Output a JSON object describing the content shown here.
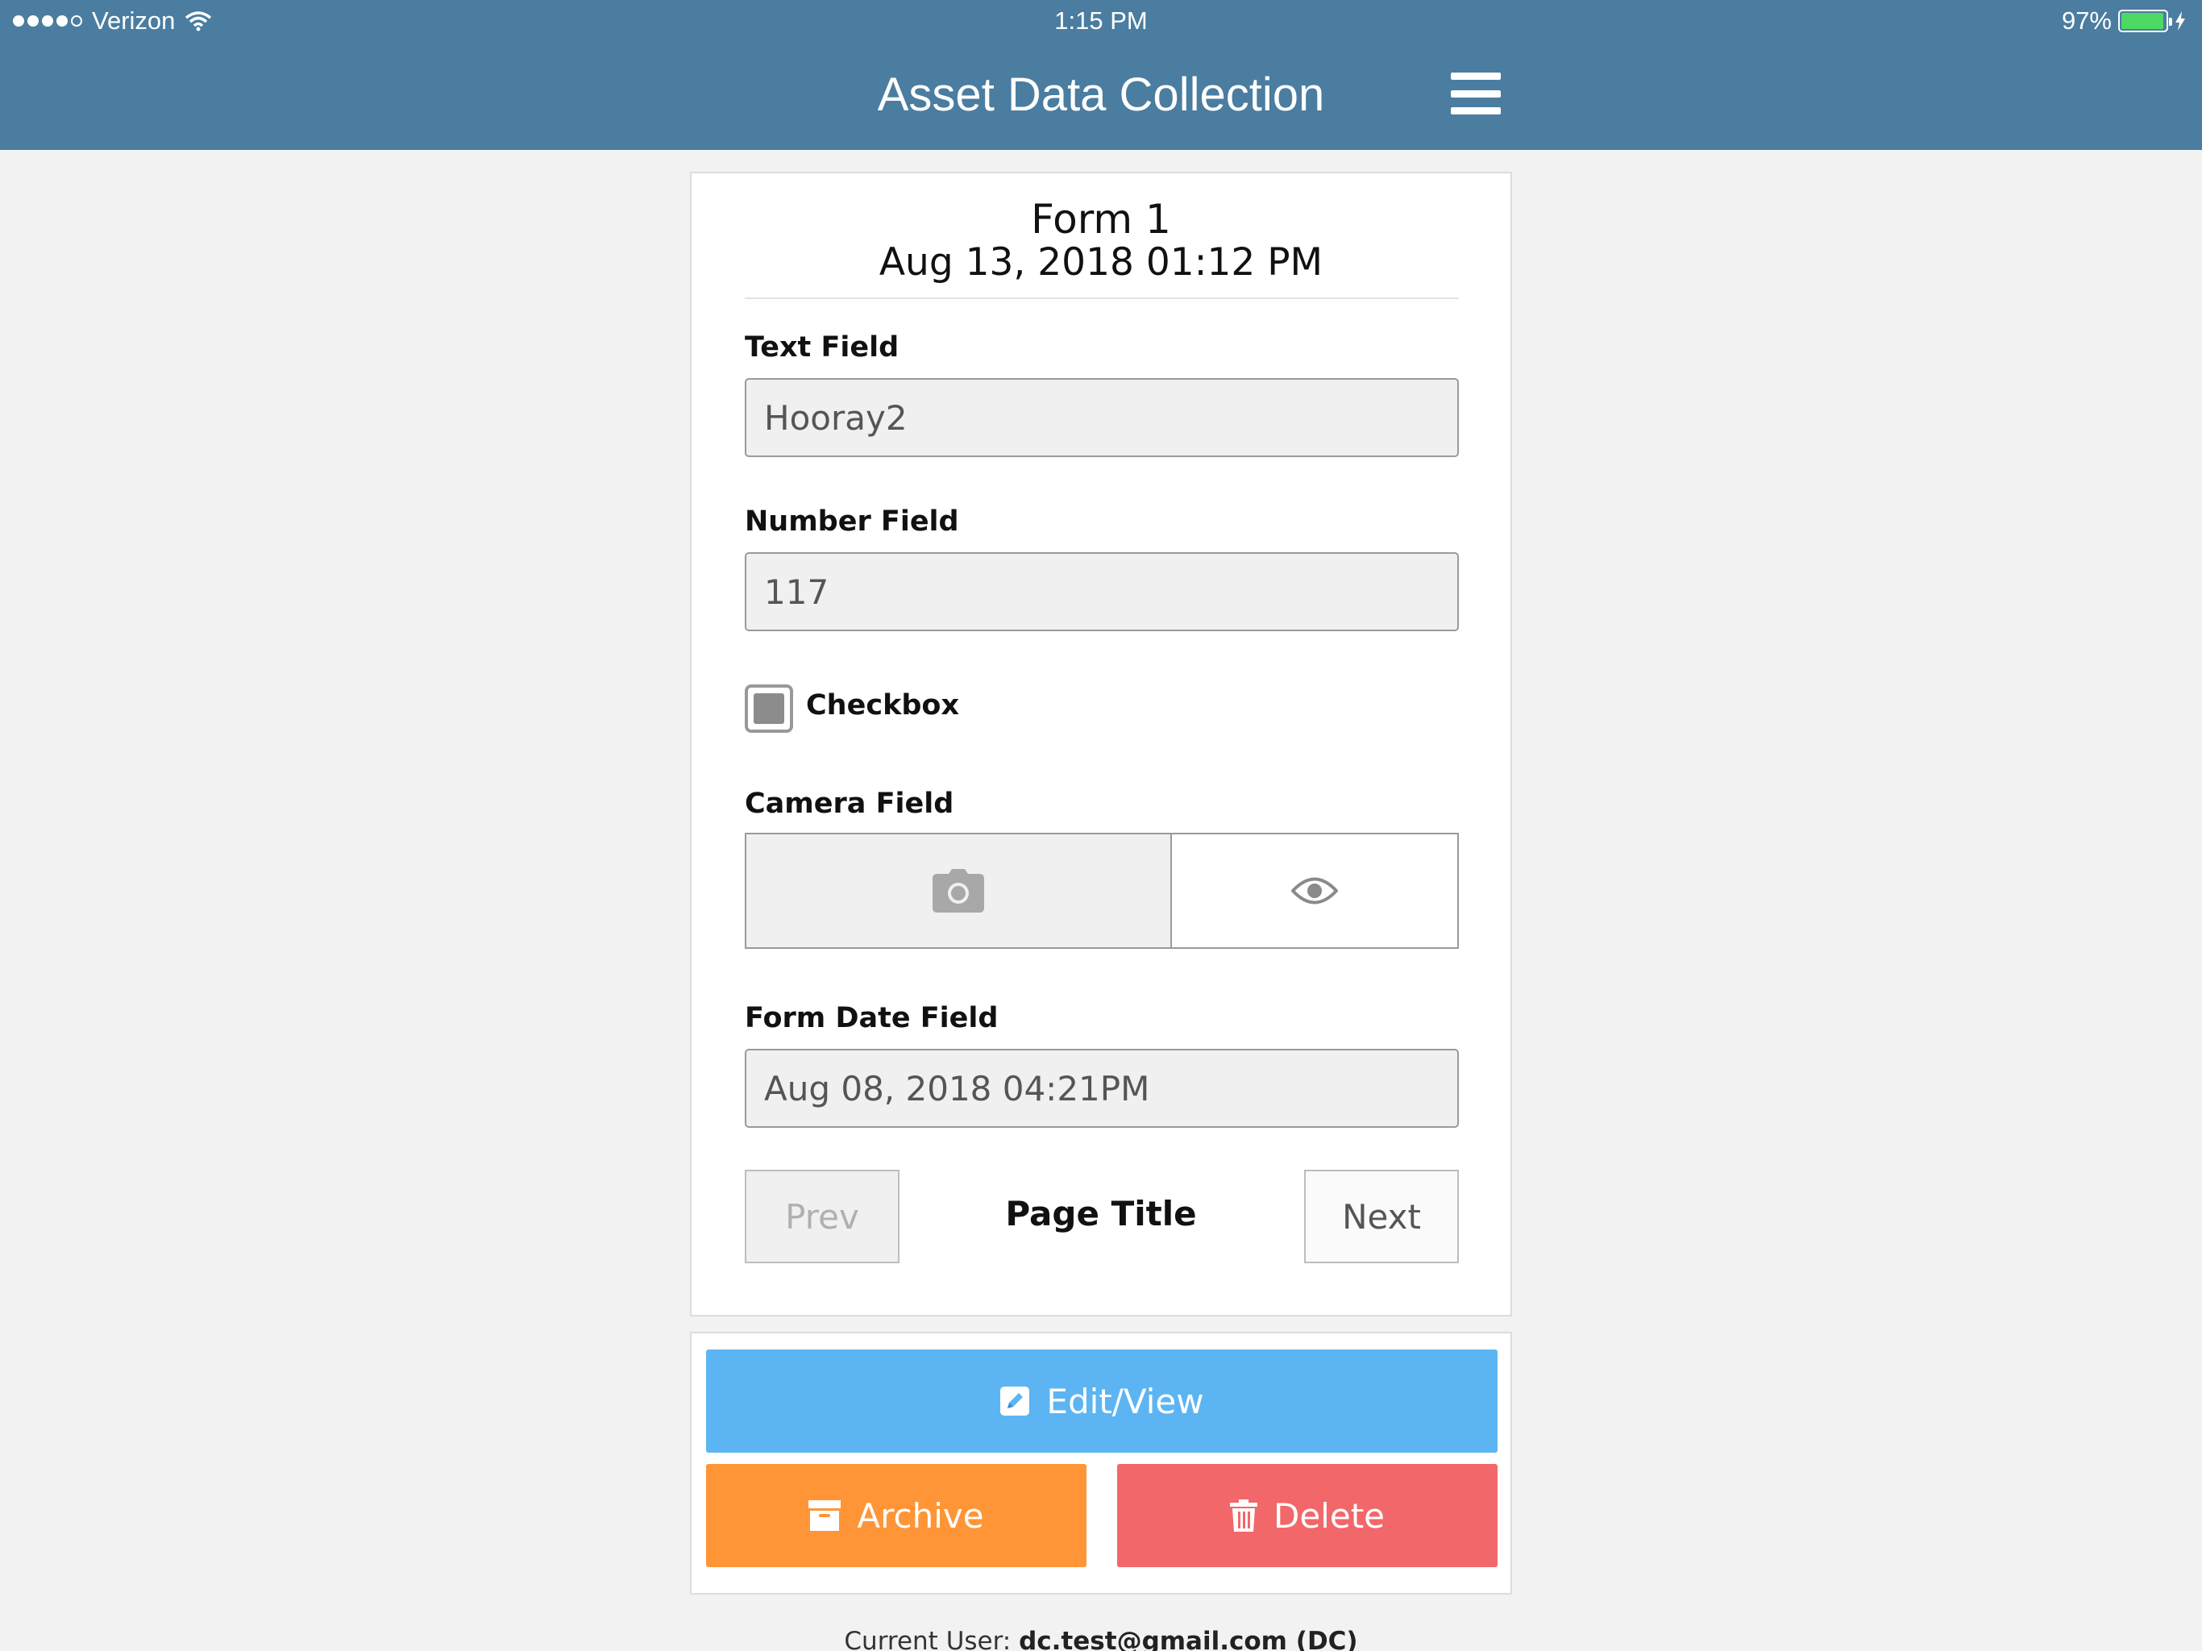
{
  "status_bar": {
    "carrier": "Verizon",
    "time": "1:15 PM",
    "battery": "97%",
    "battery_level": 0.97
  },
  "header": {
    "title": "Asset Data Collection"
  },
  "form": {
    "title": "Form 1",
    "date": "Aug 13, 2018 01:12 PM",
    "fields": {
      "text_label": "Text Field",
      "text_value": "Hooray2",
      "number_label": "Number Field",
      "number_value": "117",
      "checkbox_label": "Checkbox",
      "checkbox_checked": true,
      "camera_label": "Camera Field",
      "date_label": "Form Date Field",
      "date_value": "Aug 08, 2018 04:21PM"
    },
    "pager": {
      "prev": "Prev",
      "title": "Page Title",
      "next": "Next"
    }
  },
  "actions": {
    "edit": "Edit/View",
    "archive": "Archive",
    "delete": "Delete"
  },
  "footer": {
    "prefix": "Current User:",
    "user": "dc.test@gmail.com (DC)"
  },
  "colors": {
    "header": "#4a7da0",
    "edit": "#5cb5f2",
    "archive": "#ff9537",
    "delete": "#f2676a"
  }
}
